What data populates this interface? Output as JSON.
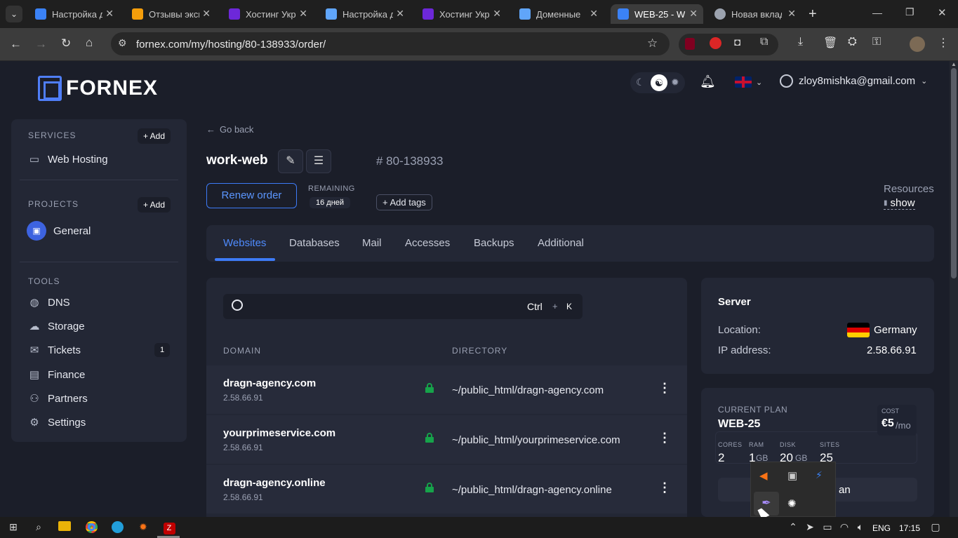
{
  "browser": {
    "tabs": [
      {
        "title": "Настройка д",
        "color": "#3b82f6"
      },
      {
        "title": "Отзывы эксп",
        "color": "#f59e0b"
      },
      {
        "title": "Хостинг Укр",
        "color": "#6d28d9"
      },
      {
        "title": "Настройка д",
        "color": "#60a5fa"
      },
      {
        "title": "Хостинг Укр",
        "color": "#6d28d9"
      },
      {
        "title": "Доменные",
        "color": "#60a5fa"
      },
      {
        "title": "WEB-25 - W",
        "color": "#3b82f6"
      },
      {
        "title": "Новая вклад",
        "color": "#9ca3af"
      }
    ],
    "new_tab": "+",
    "url": "fornex.com/my/hosting/80-138933/order/"
  },
  "header": {
    "logo_text": "FORNEX",
    "user_email": "zloy8mishka@gmail.com"
  },
  "sidebar": {
    "services_label": "SERVICES",
    "services_add": "+ Add",
    "web_hosting": "Web Hosting",
    "projects_label": "PROJECTS",
    "projects_add": "+ Add",
    "project_general": "General",
    "tools_label": "TOOLS",
    "tools": [
      {
        "label": "DNS",
        "icon": "globe-icon"
      },
      {
        "label": "Storage",
        "icon": "cloud-icon"
      },
      {
        "label": "Tickets",
        "icon": "chat-icon",
        "badge": "1"
      },
      {
        "label": "Finance",
        "icon": "wallet-icon"
      },
      {
        "label": "Partners",
        "icon": "users-icon"
      },
      {
        "label": "Settings",
        "icon": "gear-icon"
      }
    ]
  },
  "order": {
    "go_back": "Go back",
    "name": "work-web",
    "number": "# 80-138933",
    "renew": "Renew order",
    "remaining_label": "REMAINING",
    "remaining_value": "16 дней",
    "add_tags": "+ Add tags",
    "resources_label": "Resources",
    "resources_show": "show"
  },
  "tabs": [
    "Websites",
    "Databases",
    "Mail",
    "Accesses",
    "Backups",
    "Additional"
  ],
  "search": {
    "placeholder": "",
    "shortcut_ctrl": "Ctrl",
    "shortcut_plus": "+",
    "shortcut_key": "K"
  },
  "table": {
    "col_domain": "DOMAIN",
    "col_directory": "DIRECTORY",
    "rows": [
      {
        "domain": "dragn-agency.com",
        "ip": "2.58.66.91",
        "dir": "~/public_html/dragn-agency.com"
      },
      {
        "domain": "yourprimeservice.com",
        "ip": "2.58.66.91",
        "dir": "~/public_html/yourprimeservice.com"
      },
      {
        "domain": "dragn-agency.online",
        "ip": "2.58.66.91",
        "dir": "~/public_html/dragn-agency.online"
      }
    ]
  },
  "server": {
    "title": "Server",
    "location_label": "Location:",
    "location_value": "Germany",
    "ip_label": "IP address:",
    "ip_value": "2.58.66.91"
  },
  "plan": {
    "label": "CURRENT PLAN",
    "name": "WEB-25",
    "cost_label": "COST",
    "cost_value": "€5",
    "cost_unit": "/mo",
    "cores_label": "CORES",
    "cores_value": "2",
    "ram_label": "RAM",
    "ram_value": "1",
    "ram_unit": "GB",
    "disk_label": "DISK",
    "disk_value": "20",
    "disk_unit": "GB",
    "sites_label": "SITES",
    "sites_value": "25",
    "change_btn_visible": "an"
  },
  "taskbar": {
    "lang": "ENG",
    "time": "17:15"
  },
  "colors": {
    "accent": "#3d7bf7",
    "background": "#1b1e29",
    "card": "#232735",
    "lock_green": "#22c55e"
  }
}
